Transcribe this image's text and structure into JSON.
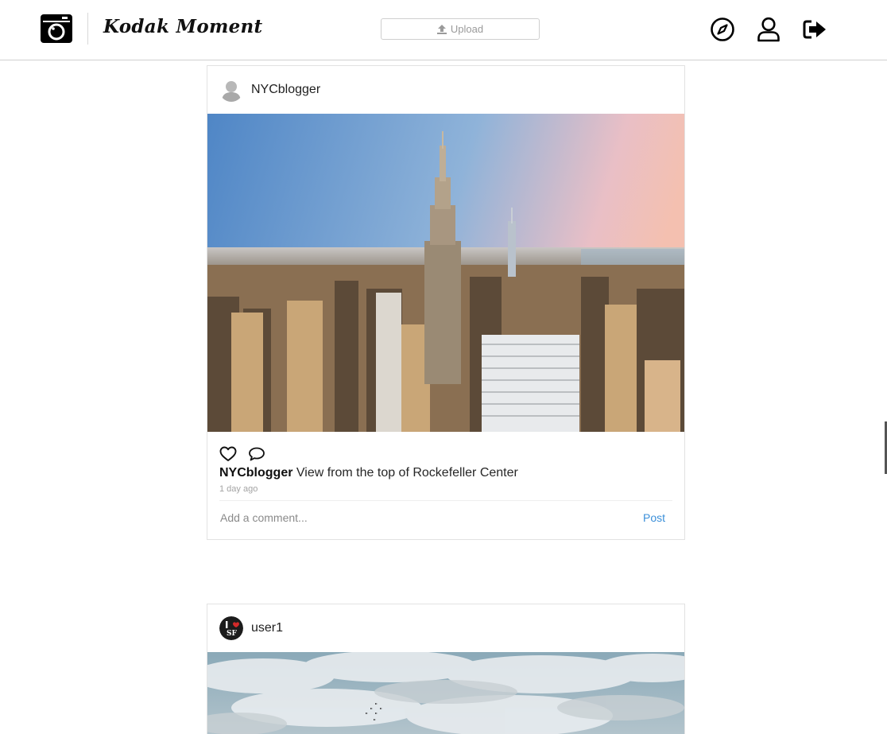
{
  "header": {
    "brand": "Kodak Moment",
    "upload_label": "Upload",
    "icons": [
      "camera-logo-icon",
      "upload-icon",
      "compass-icon",
      "user-icon",
      "sign-out-icon"
    ]
  },
  "posts": [
    {
      "username": "NYCblogger",
      "caption_user": "NYCblogger",
      "caption_text": " View from the top of Rockefeller Center",
      "timestamp": "1 day ago",
      "comment_placeholder": "Add a comment...",
      "post_label": "Post"
    },
    {
      "username": "user1"
    }
  ],
  "colors": {
    "accent": "#3b8fd9",
    "border": "#e2e2e2",
    "muted": "#a3a3a3"
  }
}
